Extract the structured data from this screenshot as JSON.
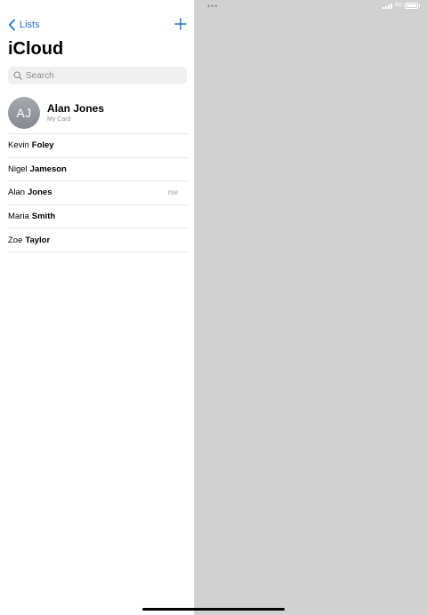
{
  "status_bar": {
    "dots": "•••",
    "network": "5G"
  },
  "nav": {
    "back_label": "Lists",
    "add_icon": "plus-icon"
  },
  "title": "iCloud",
  "search": {
    "placeholder": "Search",
    "value": ""
  },
  "my_card": {
    "initials": "AJ",
    "name": "Alan Jones",
    "subtitle": "My Card"
  },
  "contacts": [
    {
      "first": "Kevin",
      "last": "Foley",
      "tag": ""
    },
    {
      "first": "Nigel",
      "last": "Jameson",
      "tag": ""
    },
    {
      "first": "Alan",
      "last": "Jones",
      "tag": "me"
    },
    {
      "first": "Maria",
      "last": "Smith",
      "tag": ""
    },
    {
      "first": "Zoe",
      "last": "Taylor",
      "tag": ""
    }
  ],
  "colors": {
    "accent": "#1a73c8",
    "detail_background": "#d1d1d1",
    "search_background": "#efeff0"
  }
}
